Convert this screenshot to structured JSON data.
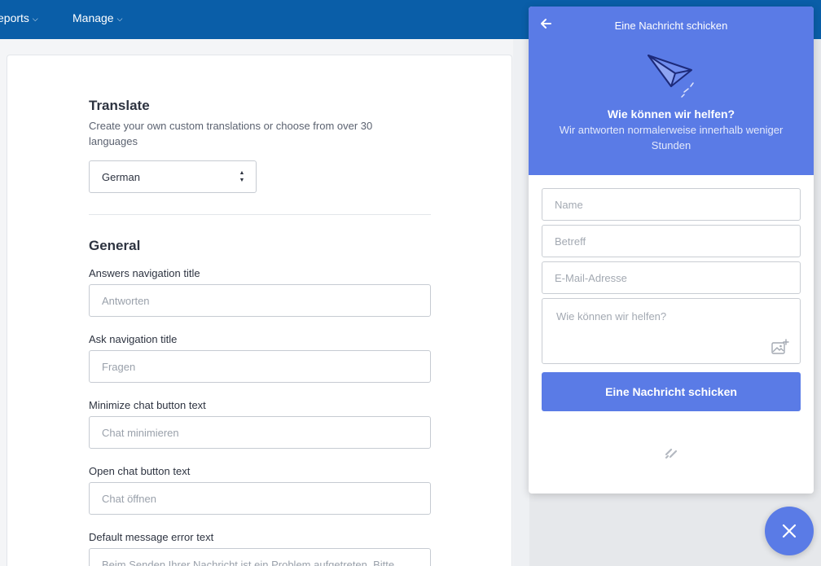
{
  "nav": {
    "items": [
      {
        "label": "Reports",
        "shown": "eports"
      },
      {
        "label": "Manage"
      }
    ]
  },
  "translate": {
    "title": "Translate",
    "description": "Create your own custom translations or choose from over 30 languages",
    "language_value": "German"
  },
  "general": {
    "title": "General",
    "fields": [
      {
        "label": "Answers navigation title",
        "placeholder": "Antworten"
      },
      {
        "label": "Ask navigation title",
        "placeholder": "Fragen"
      },
      {
        "label": "Minimize chat button text",
        "placeholder": "Chat minimieren"
      },
      {
        "label": "Open chat button text",
        "placeholder": "Chat öffnen"
      },
      {
        "label": "Default message error text",
        "placeholder": "Beim Senden Ihrer Nachricht ist ein Problem aufgetreten. Bitte"
      }
    ]
  },
  "widget": {
    "title": "Eine Nachricht schicken",
    "heading": "Wie können wir helfen?",
    "subheading": "Wir antworten normalerweise innerhalb weniger Stunden",
    "name_placeholder": "Name",
    "subject_placeholder": "Betreff",
    "email_placeholder": "E-Mail-Adresse",
    "message_placeholder": "Wie können wir helfen?",
    "send_label": "Eine Nachricht schicken",
    "accent_color": "#5a7be6"
  },
  "colors": {
    "topnav": "#0a5ea8",
    "accent": "#5a7be6"
  },
  "icons": [
    "chevron-down-icon",
    "back-arrow-icon",
    "paper-plane-icon",
    "image-upload-icon",
    "brand-logo-icon",
    "close-icon"
  ]
}
